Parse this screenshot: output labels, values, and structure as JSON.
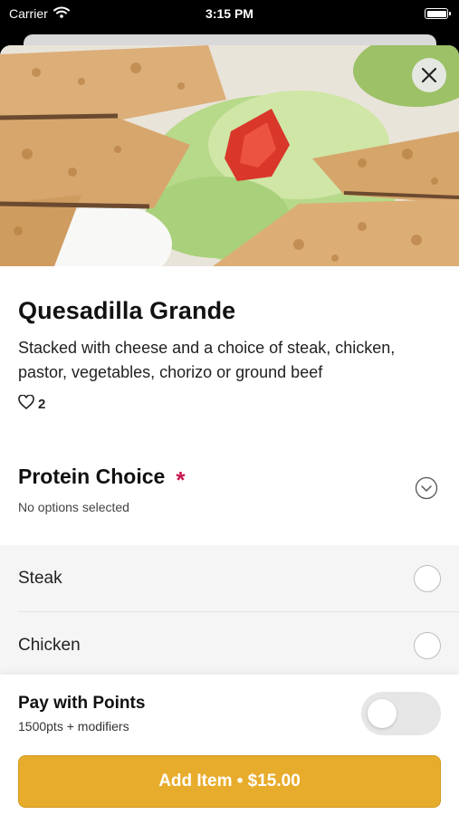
{
  "status_bar": {
    "carrier": "Carrier",
    "time": "3:15 PM"
  },
  "item": {
    "title": "Quesadilla Grande",
    "description": "Stacked with cheese and a choice of steak, chicken, pastor, vegetables, chorizo or ground beef",
    "likes": "2"
  },
  "modifier_group": {
    "title": "Protein Choice",
    "required_mark": "*",
    "subtitle": "No options selected",
    "options": [
      {
        "label": "Steak"
      },
      {
        "label": "Chicken"
      }
    ]
  },
  "points": {
    "title": "Pay with Points",
    "subtitle": "1500pts + modifiers",
    "enabled": false
  },
  "add_button": {
    "label": "Add Item • $15.00"
  },
  "colors": {
    "accent": "#e8ac2c",
    "required": "#c8164e"
  },
  "icons": [
    "wifi-icon",
    "battery-icon",
    "close-icon",
    "heart-icon",
    "chevron-down-icon"
  ]
}
